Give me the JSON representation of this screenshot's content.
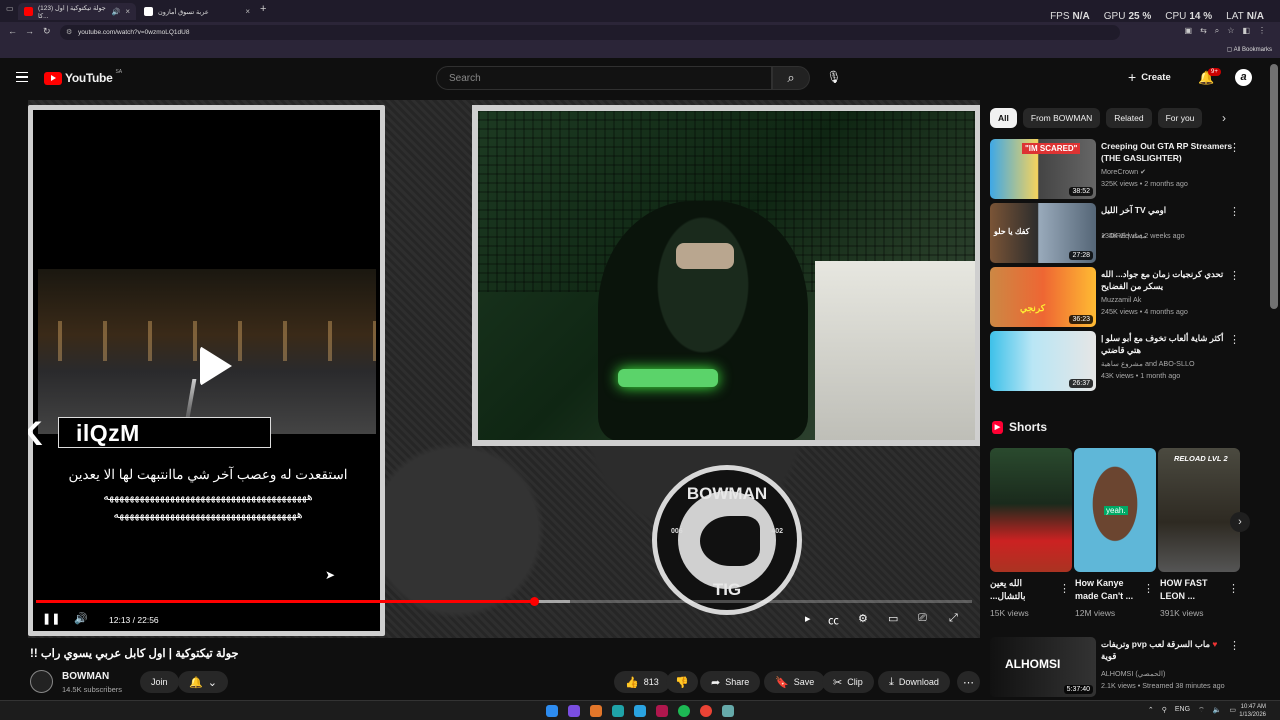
{
  "browser": {
    "tabs": [
      {
        "title": "(123) جولة تيكتوكية | اول كا...",
        "active": true
      },
      {
        "title": "عربة تسوق أمازون",
        "active": false
      }
    ],
    "url": "youtube.com/watch?v=0wzmoLQ1dU8",
    "bookmarks_label": "All Bookmarks"
  },
  "overlay": {
    "fps_label": "FPS",
    "fps_value": "N/A",
    "gpu_label": "GPU",
    "gpu_value": "25 %",
    "cpu_label": "CPU",
    "cpu_value": "14 %",
    "lat_label": "LAT",
    "lat_value": "N/A"
  },
  "header": {
    "logo": "YouTube",
    "country_code": "SA",
    "search_placeholder": "Search",
    "create_label": "Create",
    "notif_count": "9+"
  },
  "player": {
    "stream_name": "ilQzM",
    "caption_line1": "استقعدت له وعصب آخر شي ماانتبهت لها الا يعدين",
    "caption_line2": "ههههههههههههههههههههههههههههههههههههههههه",
    "caption_line3": "ههههههههههههههههههههههههههههههههههههه",
    "emblem_top": "BOWMAN",
    "emblem_bottom": "TIG",
    "emblem_left": "006",
    "emblem_right": "402",
    "time_current": "12:13",
    "time_total": "22:56",
    "progress_fraction": 0.5325,
    "buffer_fraction": 0.57
  },
  "video": {
    "title": "جولة تيكتوكية | اول كابل عربي يسوي راب !!",
    "channel": "BOWMAN",
    "subscribers": "14.5K subscribers",
    "join_label": "Join",
    "likes": "813",
    "share_label": "Share",
    "save_label": "Save",
    "clip_label": "Clip",
    "download_label": "Download"
  },
  "sidebar": {
    "chips": [
      "All",
      "From BOWMAN",
      "Related",
      "For you"
    ],
    "recommendations": [
      {
        "title": "Creeping Out GTA RP Streamers (THE GASLIGHTER)",
        "channel": "MoreCrown",
        "meta": "325K views • 2 months ago",
        "duration": "38:52",
        "thumb_text": "\"IM SCARED\""
      },
      {
        "title": "اومي TV آخر الليل",
        "channel": "DiRE | ميعاد",
        "meta": "134K views • 2 weeks ago",
        "duration": "27:28",
        "thumb_text": "كفك يا حلو"
      },
      {
        "title": "تحدي كرنجيات زمان مع جواد... الله يسكر من الفضايح",
        "channel": "Muzzamil Ak",
        "meta": "245K views • 4 months ago",
        "duration": "36:23",
        "thumb_text": "كرنجي"
      },
      {
        "title": "أكثر شاية ألعاب تخوف مع أبو سلو | هتي قاضتي",
        "channel": "مشروع ساهية and ABO-SLLO",
        "meta": "43K views • 1 month ago",
        "duration": "26:37",
        "thumb_text": ""
      }
    ],
    "shorts_heading": "Shorts",
    "shorts": [
      {
        "title": "الله يعين بالتشال...",
        "views": "15K views",
        "thumb_text": ""
      },
      {
        "title": "How Kanye made Can't ...",
        "views": "12M views",
        "thumb_text": "yeah."
      },
      {
        "title": "HOW FAST LEON ...",
        "views": "391K views",
        "thumb_text": "RELOAD LVL 2"
      }
    ],
    "live": {
      "title": "ماب السرقة لعب pvp وتريفات قوية",
      "channel": "ALHOMSI (الحمصي)",
      "meta": "2.1K views • Streamed 38 minutes ago",
      "duration": "5:37:40",
      "thumb_text": "ALHOMSI"
    }
  },
  "taskbar": {
    "lang": "ENG",
    "time": "10:47 AM",
    "date": "1/13/2026"
  },
  "colors": {
    "brand_red": "#ff0000",
    "background": "#0f0f0f",
    "chip_bg": "#272727"
  }
}
